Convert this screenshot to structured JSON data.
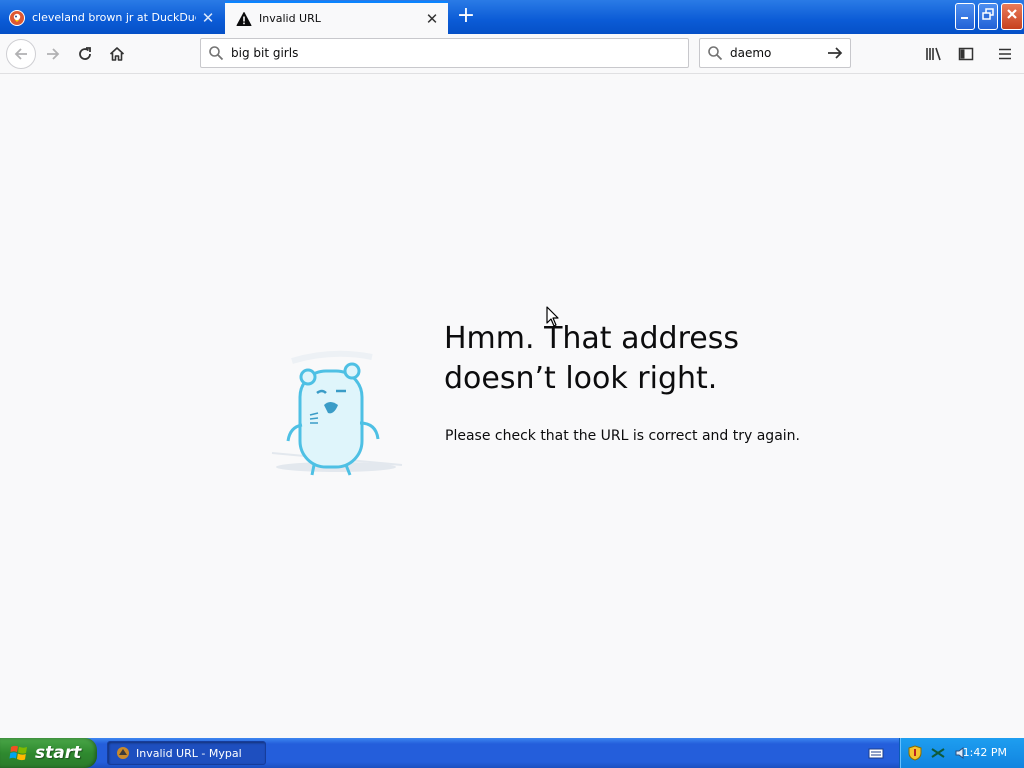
{
  "tabs": [
    {
      "label": "cleveland brown jr at DuckDuckGo",
      "icon": "duckduckgo-icon",
      "active": false
    },
    {
      "label": "Invalid URL",
      "icon": "warning-icon",
      "active": true
    }
  ],
  "window_controls": {
    "minimize": "minimize-icon",
    "restore": "restore-icon",
    "close": "close-icon"
  },
  "toolbar": {
    "url_value": "big bit girls",
    "search_value": "daemo"
  },
  "error_page": {
    "title": "Hmm. That address doesn’t look right.",
    "description": "Please check that the URL is correct and try again."
  },
  "taskbar": {
    "start_label": "start",
    "task_label": "Invalid URL - Mypal",
    "clock": "1:42 PM"
  },
  "colors": {
    "tabstrip_blue": "#0b5bd6",
    "taskbar_blue": "#245edb",
    "start_green": "#2f8a2f",
    "page_background": "#f9f9fa"
  }
}
